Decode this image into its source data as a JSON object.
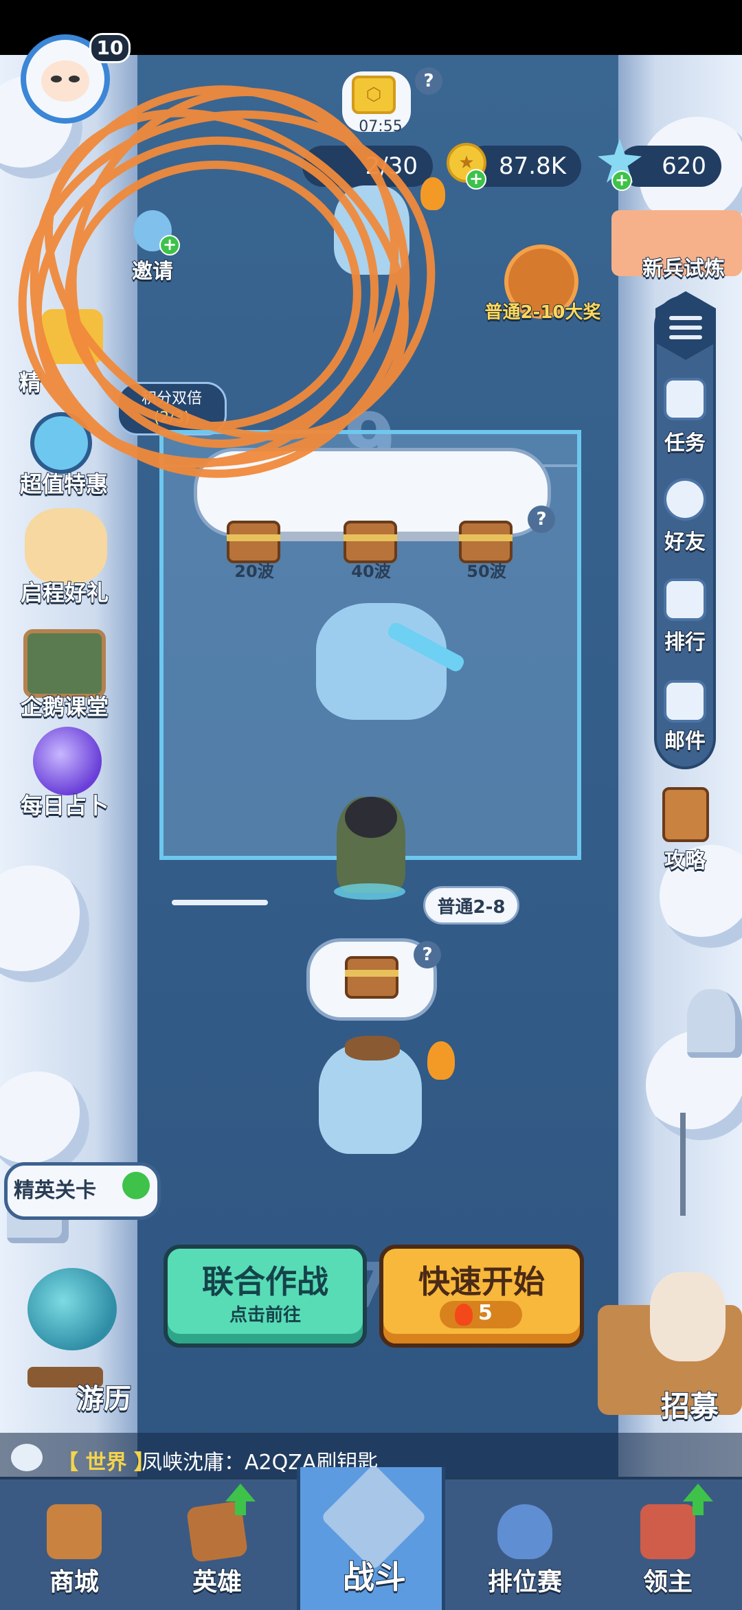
{
  "hud": {
    "level": "10",
    "stamina": "2/30",
    "gold": "87.8K",
    "gems": "620",
    "chest_counter": "07:55"
  },
  "left_menu": [
    {
      "label": "邀请"
    },
    {
      "label": "精英关卡"
    },
    {
      "label": "超值特惠"
    },
    {
      "label": "启程好礼"
    },
    {
      "label": "企鹅课堂"
    },
    {
      "label": "每日占卜"
    }
  ],
  "partial_labels": {
    "elite_top": "精",
    "points_double": "积分双倍",
    "points_progress": "(2/3)"
  },
  "right_menu": {
    "recruit_trial": "新兵试炼",
    "reward_badge": "普通2-10大奖",
    "items": [
      {
        "label": "任务"
      },
      {
        "label": "好友"
      },
      {
        "label": "排行"
      },
      {
        "label": "邮件"
      }
    ],
    "guide": "攻略"
  },
  "stage": {
    "current_number": "9",
    "next_number": "7",
    "wave_rewards": [
      "20波",
      "40波",
      "50波"
    ],
    "stage_label": "普通2-8",
    "help_symbol": "?"
  },
  "bottom_left": {
    "elite_stage": "精英关卡",
    "travel": "游历"
  },
  "bottom_right": {
    "recruit": "招募"
  },
  "buttons": {
    "coop_title": "联合作战",
    "coop_sub": "点击前往",
    "quick_title": "快速开始",
    "quick_cost": "5"
  },
  "chat": {
    "channel": "【 世界 】",
    "message": "凤峡沈庸：A2QZA刷钥匙"
  },
  "nav": [
    {
      "label": "商城"
    },
    {
      "label": "英雄"
    },
    {
      "label": "战斗"
    },
    {
      "label": "排位赛"
    },
    {
      "label": "领主"
    }
  ],
  "colors": {
    "river": "#33577f",
    "snow": "#e8f0fa",
    "coop": "#58dcb6",
    "quick": "#f7b83b",
    "nav": "#3b5a83",
    "nav_active": "#5c9be0",
    "scribble": "#f08a3c"
  }
}
